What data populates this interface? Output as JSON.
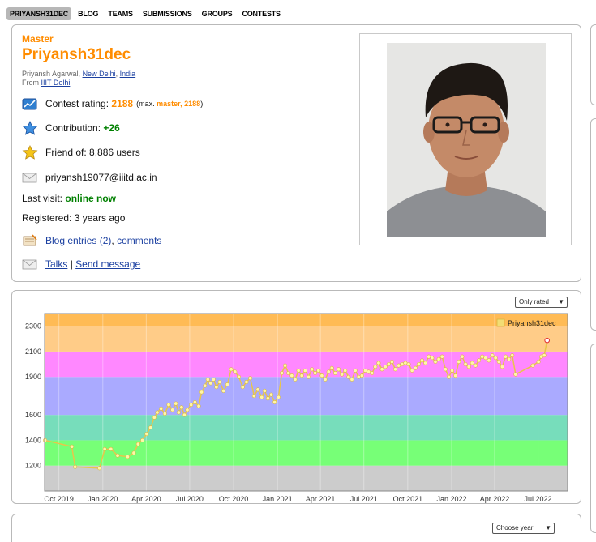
{
  "nav": {
    "items": [
      "PRIYANSH31DEC",
      "BLOG",
      "TEAMS",
      "SUBMISSIONS",
      "GROUPS",
      "CONTESTS"
    ]
  },
  "profile": {
    "rank": "Master",
    "handle": "Priyansh31dec",
    "full_name": "Priyansh Agarwal,",
    "city": "New Delhi",
    "country": "India",
    "from_label": "From",
    "organization": "IIIT Delhi",
    "contest_rating_label": "Contest rating:",
    "contest_rating": "2188",
    "max_prefix": "(max.",
    "max_rank": "master,",
    "max_rating": "2188",
    "max_suffix": ")",
    "contribution_label": "Contribution:",
    "contribution": "+26",
    "friend_label": "Friend of:",
    "friend_count": "8,886 users",
    "email": "priyansh19077@iiitd.ac.in",
    "last_visit_label": "Last visit:",
    "last_visit": "online now",
    "registered": "Registered: 3 years ago",
    "blog_entries": "Blog entries (2)",
    "comments": "comments",
    "talks": "Talks",
    "send_message": "Send message",
    "separator": "|",
    "comma": ","
  },
  "icons": {
    "rating": "rating-chart-icon",
    "contribution": "blue-star-icon",
    "friend": "gold-star-icon",
    "email": "envelope-icon",
    "blog": "blog-icon",
    "talks": "message-icon"
  },
  "controls": {
    "rated_filter": "Only rated",
    "year_select": "Choose year"
  },
  "colors": {
    "accent": "#ff8c00",
    "online": "#008000",
    "link": "#1a3fa0",
    "line": "#e8c54a",
    "point": "#fff6a8"
  },
  "chart_data": {
    "type": "line",
    "title": "",
    "xlabel": "",
    "ylabel": "",
    "legend": "top-right",
    "ylim": [
      1000,
      2400
    ],
    "xlim": [
      "2019-09-01",
      "2022-09-01"
    ],
    "y_ticks": [
      1200,
      1400,
      1600,
      1900,
      2100,
      2300
    ],
    "x_ticks": [
      "Oct 2019",
      "Jan 2020",
      "Apr 2020",
      "Jul 2020",
      "Oct 2020",
      "Jan 2021",
      "Apr 2021",
      "Jul 2021",
      "Oct 2021",
      "Jan 2022",
      "Apr 2022",
      "Jul 2022"
    ],
    "x_tick_dates": [
      "2019-10-01",
      "2020-01-01",
      "2020-04-01",
      "2020-07-01",
      "2020-10-01",
      "2021-01-01",
      "2021-04-01",
      "2021-07-01",
      "2021-10-01",
      "2022-01-01",
      "2022-04-01",
      "2022-07-01"
    ],
    "bands": [
      {
        "from": 1000,
        "to": 1200,
        "color": "#cccccc"
      },
      {
        "from": 1200,
        "to": 1400,
        "color": "#77ff77"
      },
      {
        "from": 1400,
        "to": 1600,
        "color": "#77ddbb"
      },
      {
        "from": 1600,
        "to": 1900,
        "color": "#aaaaff"
      },
      {
        "from": 1900,
        "to": 2100,
        "color": "#ff88ff"
      },
      {
        "from": 2100,
        "to": 2300,
        "color": "#ffcc88"
      },
      {
        "from": 2300,
        "to": 2400,
        "color": "#ffbb55"
      }
    ],
    "series": [
      {
        "name": "Priyansh31dec",
        "points": [
          [
            "2019-09-02",
            1400
          ],
          [
            "2019-10-28",
            1350
          ],
          [
            "2019-11-04",
            1190
          ],
          [
            "2019-12-25",
            1180
          ],
          [
            "2020-01-05",
            1330
          ],
          [
            "2020-01-18",
            1330
          ],
          [
            "2020-02-01",
            1280
          ],
          [
            "2020-02-22",
            1270
          ],
          [
            "2020-03-06",
            1300
          ],
          [
            "2020-03-15",
            1370
          ],
          [
            "2020-03-24",
            1400
          ],
          [
            "2020-04-02",
            1450
          ],
          [
            "2020-04-10",
            1500
          ],
          [
            "2020-04-18",
            1580
          ],
          [
            "2020-04-24",
            1620
          ],
          [
            "2020-05-02",
            1650
          ],
          [
            "2020-05-10",
            1610
          ],
          [
            "2020-05-18",
            1680
          ],
          [
            "2020-05-26",
            1640
          ],
          [
            "2020-06-02",
            1690
          ],
          [
            "2020-06-08",
            1620
          ],
          [
            "2020-06-14",
            1660
          ],
          [
            "2020-06-20",
            1600
          ],
          [
            "2020-06-26",
            1640
          ],
          [
            "2020-07-04",
            1680
          ],
          [
            "2020-07-12",
            1700
          ],
          [
            "2020-07-20",
            1670
          ],
          [
            "2020-07-26",
            1780
          ],
          [
            "2020-08-02",
            1830
          ],
          [
            "2020-08-08",
            1880
          ],
          [
            "2020-08-14",
            1850
          ],
          [
            "2020-08-20",
            1880
          ],
          [
            "2020-08-26",
            1820
          ],
          [
            "2020-09-02",
            1860
          ],
          [
            "2020-09-10",
            1790
          ],
          [
            "2020-09-18",
            1840
          ],
          [
            "2020-09-26",
            1960
          ],
          [
            "2020-10-04",
            1940
          ],
          [
            "2020-10-12",
            1900
          ],
          [
            "2020-10-20",
            1820
          ],
          [
            "2020-10-28",
            1860
          ],
          [
            "2020-11-05",
            1890
          ],
          [
            "2020-11-13",
            1750
          ],
          [
            "2020-11-21",
            1800
          ],
          [
            "2020-11-29",
            1740
          ],
          [
            "2020-12-05",
            1790
          ],
          [
            "2020-12-12",
            1730
          ],
          [
            "2020-12-19",
            1760
          ],
          [
            "2020-12-26",
            1700
          ],
          [
            "2021-01-03",
            1740
          ],
          [
            "2021-01-10",
            1930
          ],
          [
            "2021-01-17",
            1990
          ],
          [
            "2021-01-24",
            1930
          ],
          [
            "2021-01-31",
            1910
          ],
          [
            "2021-02-07",
            1880
          ],
          [
            "2021-02-14",
            1950
          ],
          [
            "2021-02-21",
            1910
          ],
          [
            "2021-02-28",
            1950
          ],
          [
            "2021-03-07",
            1900
          ],
          [
            "2021-03-14",
            1960
          ],
          [
            "2021-03-21",
            1930
          ],
          [
            "2021-03-28",
            1950
          ],
          [
            "2021-04-04",
            1910
          ],
          [
            "2021-04-11",
            1880
          ],
          [
            "2021-04-18",
            1940
          ],
          [
            "2021-04-25",
            1970
          ],
          [
            "2021-05-02",
            1930
          ],
          [
            "2021-05-09",
            1960
          ],
          [
            "2021-05-16",
            1920
          ],
          [
            "2021-05-23",
            1950
          ],
          [
            "2021-05-30",
            1900
          ],
          [
            "2021-06-06",
            1880
          ],
          [
            "2021-06-13",
            1950
          ],
          [
            "2021-06-20",
            1900
          ],
          [
            "2021-06-27",
            1910
          ],
          [
            "2021-07-04",
            1950
          ],
          [
            "2021-07-11",
            1940
          ],
          [
            "2021-07-18",
            1930
          ],
          [
            "2021-07-25",
            1980
          ],
          [
            "2021-08-01",
            2010
          ],
          [
            "2021-08-08",
            1960
          ],
          [
            "2021-08-15",
            1980
          ],
          [
            "2021-08-22",
            2000
          ],
          [
            "2021-08-29",
            2020
          ],
          [
            "2021-09-05",
            1960
          ],
          [
            "2021-09-12",
            1990
          ],
          [
            "2021-09-19",
            2000
          ],
          [
            "2021-09-26",
            2010
          ],
          [
            "2021-10-03",
            2000
          ],
          [
            "2021-10-10",
            1950
          ],
          [
            "2021-10-17",
            1970
          ],
          [
            "2021-10-24",
            2000
          ],
          [
            "2021-10-31",
            2030
          ],
          [
            "2021-11-07",
            2010
          ],
          [
            "2021-11-14",
            2060
          ],
          [
            "2021-11-21",
            2050
          ],
          [
            "2021-11-28",
            2020
          ],
          [
            "2021-12-05",
            2040
          ],
          [
            "2021-12-12",
            2060
          ],
          [
            "2021-12-19",
            1960
          ],
          [
            "2021-12-26",
            1900
          ],
          [
            "2022-01-02",
            1950
          ],
          [
            "2022-01-09",
            1910
          ],
          [
            "2022-01-16",
            2020
          ],
          [
            "2022-01-23",
            2060
          ],
          [
            "2022-01-30",
            2000
          ],
          [
            "2022-02-06",
            1980
          ],
          [
            "2022-02-13",
            2010
          ],
          [
            "2022-02-20",
            1990
          ],
          [
            "2022-02-27",
            2030
          ],
          [
            "2022-03-06",
            2060
          ],
          [
            "2022-03-13",
            2050
          ],
          [
            "2022-03-20",
            2030
          ],
          [
            "2022-03-27",
            2070
          ],
          [
            "2022-04-03",
            2050
          ],
          [
            "2022-04-10",
            2020
          ],
          [
            "2022-04-17",
            1980
          ],
          [
            "2022-04-24",
            2060
          ],
          [
            "2022-05-01",
            2040
          ],
          [
            "2022-05-08",
            2070
          ],
          [
            "2022-05-15",
            1920
          ],
          [
            "2022-06-20",
            1990
          ],
          [
            "2022-07-02",
            2020
          ],
          [
            "2022-07-08",
            2060
          ],
          [
            "2022-07-14",
            2070
          ],
          [
            "2022-07-20",
            2188
          ]
        ]
      }
    ]
  }
}
